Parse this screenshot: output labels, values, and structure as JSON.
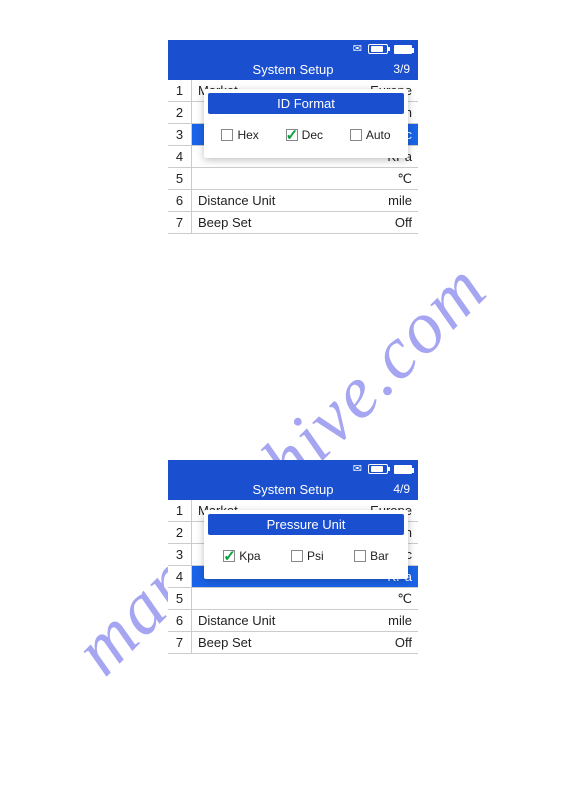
{
  "watermark": "manualshive.com",
  "device1": {
    "title": "System Setup",
    "page": "3/9",
    "rows": [
      {
        "n": "1",
        "label": "Market",
        "value": "Europe"
      },
      {
        "n": "2",
        "label": "",
        "value": "lish"
      },
      {
        "n": "3",
        "label": "",
        "value": "Dec"
      },
      {
        "n": "4",
        "label": "",
        "value": "KPa"
      },
      {
        "n": "5",
        "label": "",
        "value": "℃"
      },
      {
        "n": "6",
        "label": "Distance Unit",
        "value": "mile"
      },
      {
        "n": "7",
        "label": "Beep Set",
        "value": "Off"
      }
    ],
    "selected_index": 2,
    "popup": {
      "title": "ID Format",
      "options": [
        {
          "label": "Hex",
          "checked": false
        },
        {
          "label": "Dec",
          "checked": true
        },
        {
          "label": "Auto",
          "checked": false
        }
      ]
    }
  },
  "device2": {
    "title": "System Setup",
    "page": "4/9",
    "rows": [
      {
        "n": "1",
        "label": "Market",
        "value": "Europe"
      },
      {
        "n": "2",
        "label": "",
        "value": "lish"
      },
      {
        "n": "3",
        "label": "",
        "value": "Dec"
      },
      {
        "n": "4",
        "label": "",
        "value": "KPa"
      },
      {
        "n": "5",
        "label": "",
        "value": "℃"
      },
      {
        "n": "6",
        "label": "Distance Unit",
        "value": "mile"
      },
      {
        "n": "7",
        "label": "Beep Set",
        "value": "Off"
      }
    ],
    "selected_index": 3,
    "popup": {
      "title": "Pressure Unit",
      "options": [
        {
          "label": "Kpa",
          "checked": true
        },
        {
          "label": "Psi",
          "checked": false
        },
        {
          "label": "Bar",
          "checked": false
        }
      ]
    }
  }
}
